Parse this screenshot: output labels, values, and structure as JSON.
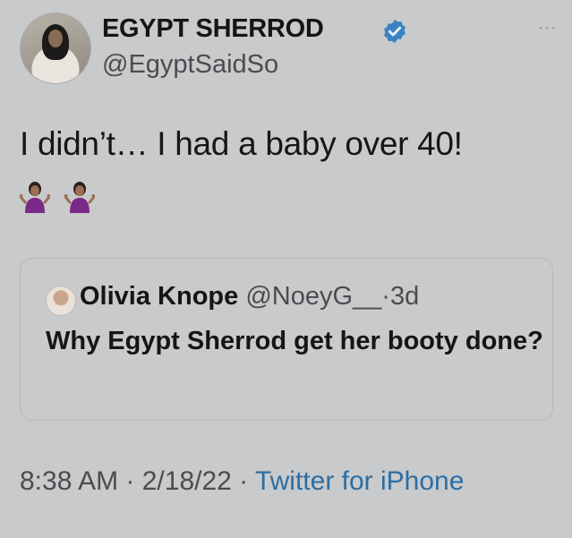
{
  "author": {
    "display_name": "EGYPT SHERROD",
    "handle": "@EgyptSaidSo",
    "verified_icon": "verified-badge-icon",
    "more_icon": "more-options-icon",
    "more_glyph": "···"
  },
  "tweet": {
    "text": "I didn’t… I had a baby over 40!",
    "emojis": [
      "person-shrugging-emoji",
      "person-shrugging-emoji"
    ]
  },
  "quoted_tweet": {
    "display_name": "Olivia Knope",
    "handle": "@NoeyG__",
    "separator": "·",
    "age": "3d",
    "text": "Why Egypt Sherrod get her booty done?"
  },
  "meta": {
    "time": "8:38 AM",
    "separator1": " · ",
    "date": "2/18/22",
    "separator2": " · ",
    "source": "Twitter for iPhone"
  },
  "colors": {
    "background": "#c9cacb",
    "text": "#161617",
    "secondary_text": "#4a4c4f",
    "link": "#2c6ea4",
    "verified": "#3a82c4"
  }
}
